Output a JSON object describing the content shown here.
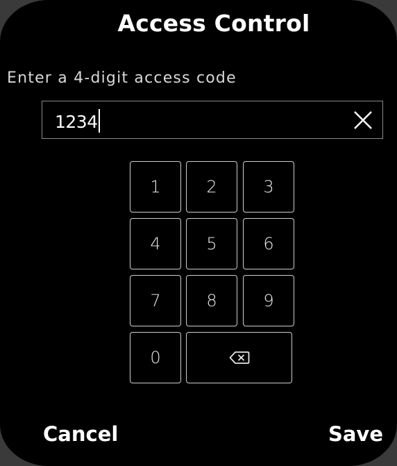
{
  "header": {
    "title": "Access Control"
  },
  "form": {
    "prompt": "Enter a 4-digit access code",
    "code_value": "1234"
  },
  "keypad": {
    "keys": [
      "1",
      "2",
      "3",
      "4",
      "5",
      "6",
      "7",
      "8",
      "9",
      "0"
    ],
    "backspace_icon": "backspace-icon"
  },
  "footer": {
    "cancel_label": "Cancel",
    "save_label": "Save"
  }
}
